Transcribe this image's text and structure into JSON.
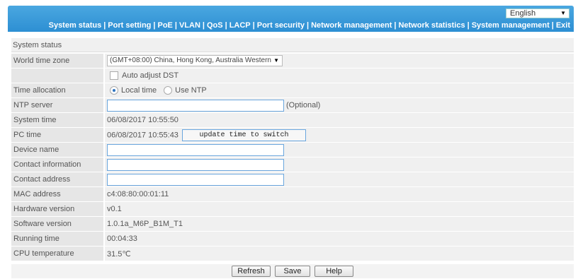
{
  "header": {
    "language": "English",
    "nav": [
      "System status",
      "Port setting",
      "PoE",
      "VLAN",
      "QoS",
      "LACP",
      "Port security",
      "Network management",
      "Network statistics",
      "System management",
      "Exit"
    ]
  },
  "section_title": "System status",
  "rows": {
    "world_time_zone": {
      "label": "World time zone",
      "value": "(GMT+08:00) China, Hong Kong, Australia Western"
    },
    "auto_dst": {
      "label": "",
      "value": "Auto adjust DST",
      "checked": false
    },
    "time_allocation": {
      "label": "Time allocation",
      "option_local": "Local time",
      "option_ntp": "Use NTP",
      "selected": "Local time"
    },
    "ntp_server": {
      "label": "NTP server",
      "value": "",
      "hint": "(Optional)"
    },
    "system_time": {
      "label": "System time",
      "value": "06/08/2017 10:55:50"
    },
    "pc_time": {
      "label": "PC time",
      "value": "06/08/2017 10:55:43",
      "button": "update time to switch"
    },
    "device_name": {
      "label": "Device name",
      "value": ""
    },
    "contact_info": {
      "label": "Contact information",
      "value": ""
    },
    "contact_address": {
      "label": "Contact address",
      "value": ""
    },
    "mac_address": {
      "label": "MAC address",
      "value": "c4:08:80:00:01:11"
    },
    "hardware_version": {
      "label": "Hardware version",
      "value": "v0.1"
    },
    "software_version": {
      "label": "Software version",
      "value": "1.0.1a_M6P_B1M_T1"
    },
    "running_time": {
      "label": "Running time",
      "value": "00:04:33"
    },
    "cpu_temperature": {
      "label": "CPU temperature",
      "value": "31.5℃"
    }
  },
  "buttons": {
    "refresh": "Refresh",
    "save": "Save",
    "help": "Help"
  }
}
